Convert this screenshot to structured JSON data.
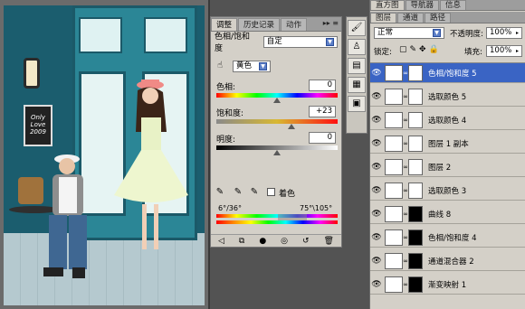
{
  "adjustments_panel": {
    "tabs": [
      "调整",
      "历史记录",
      "动作"
    ],
    "title": "色相/饱和度",
    "preset": "自定",
    "channel": "黄色",
    "hue_label": "色相:",
    "hue_value": "0",
    "saturation_label": "饱和度:",
    "saturation_value": "+23",
    "lightness_label": "明度:",
    "lightness_value": "0",
    "colorize_label": "着色",
    "range_left": "6°/36°",
    "range_right": "75°\\105°"
  },
  "layers_panel": {
    "top_tabs": [
      "直方图",
      "导航器",
      "信息"
    ],
    "tabs": [
      "图层",
      "通道",
      "路径"
    ],
    "blend_mode": "正常",
    "opacity_label": "不透明度:",
    "opacity_value": "100%",
    "lock_label": "锁定:",
    "fill_label": "填充:",
    "fill_value": "100%",
    "layers": [
      {
        "name": "色相/饱和度 5",
        "selected": true,
        "mask": "white"
      },
      {
        "name": "选取颜色 5",
        "selected": false,
        "mask": "white"
      },
      {
        "name": "选取颜色 4",
        "selected": false,
        "mask": "white"
      },
      {
        "name": "图层 1 副本",
        "selected": false,
        "mask": "white"
      },
      {
        "name": "图层 2",
        "selected": false,
        "mask": "white"
      },
      {
        "name": "选取颜色 3",
        "selected": false,
        "mask": "white"
      },
      {
        "name": "曲线 8",
        "selected": false,
        "mask": "black"
      },
      {
        "name": "色相/饱和度 4",
        "selected": false,
        "mask": "black"
      },
      {
        "name": "通道混合器 2",
        "selected": false,
        "mask": "black"
      },
      {
        "name": "渐变映射 1",
        "selected": false,
        "mask": "black"
      }
    ]
  },
  "photo": {
    "board_text": "Only Love 2009"
  },
  "colors": {
    "selected_layer": "#3a64c4",
    "panel_bg": "#d4d0c8",
    "workspace": "#535353"
  }
}
